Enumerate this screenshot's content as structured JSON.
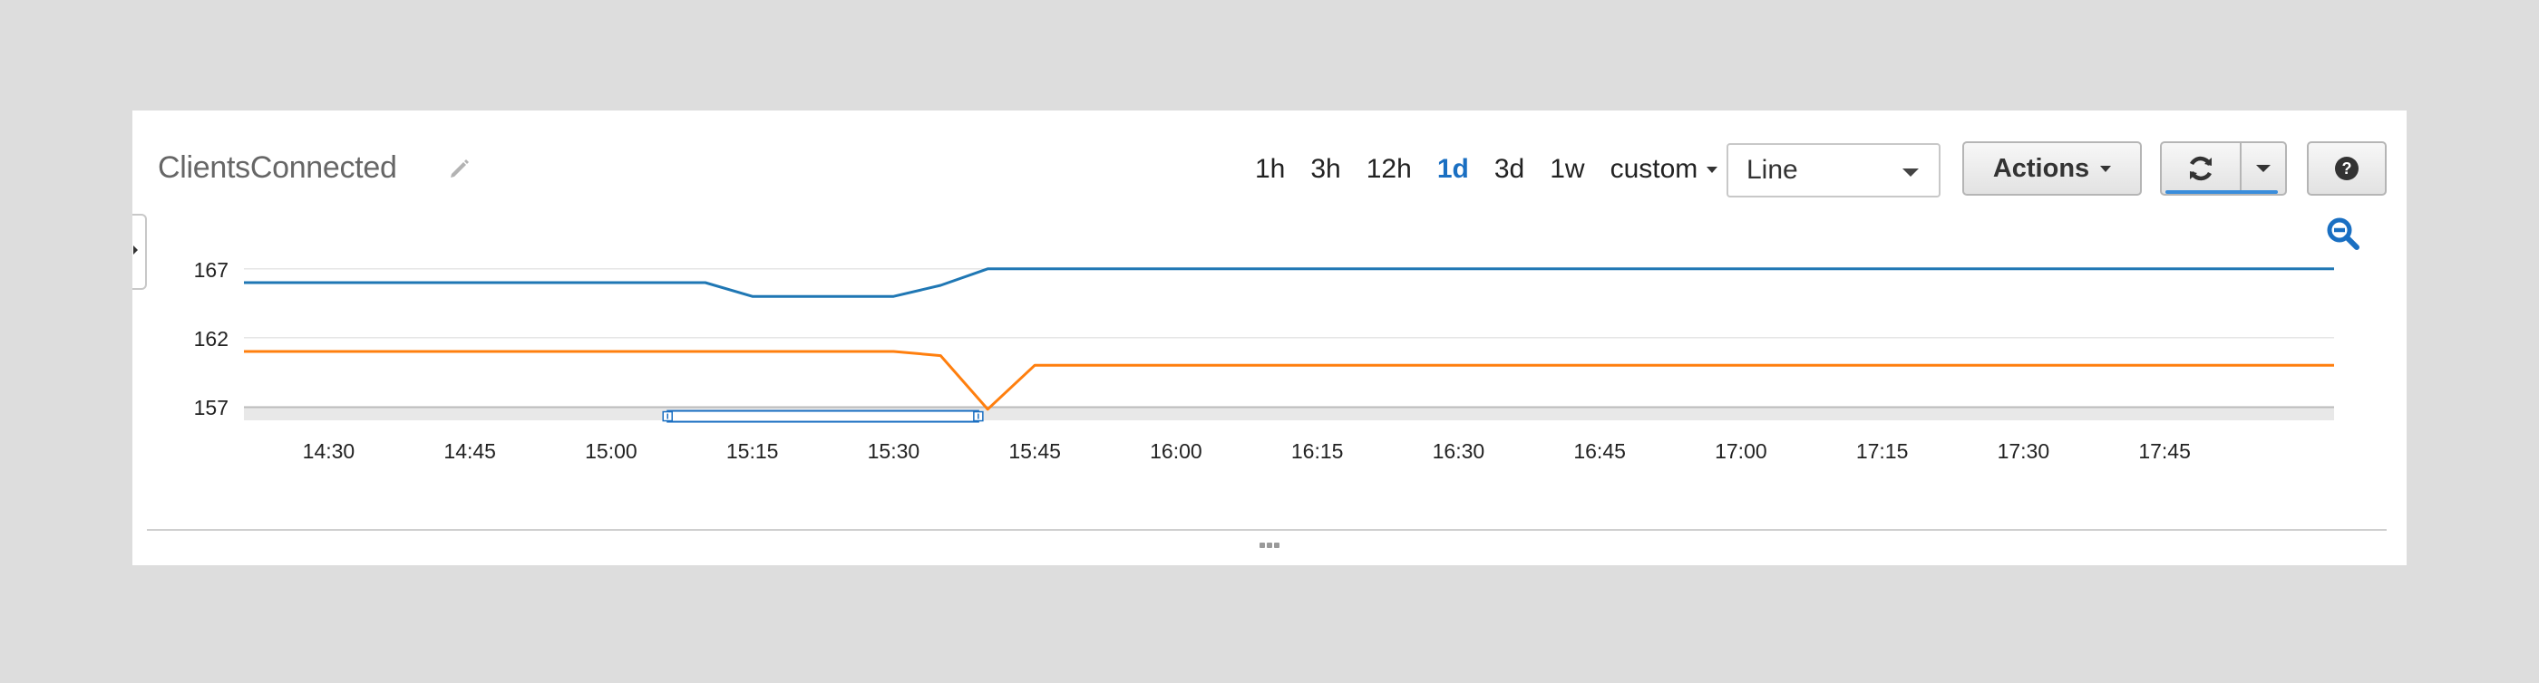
{
  "widget": {
    "title": "ClientsConnected",
    "edit_icon": "pencil-icon"
  },
  "toolbar": {
    "ranges": [
      {
        "label": "1h",
        "active": false
      },
      {
        "label": "3h",
        "active": false
      },
      {
        "label": "12h",
        "active": false
      },
      {
        "label": "1d",
        "active": true
      },
      {
        "label": "3d",
        "active": false
      },
      {
        "label": "1w",
        "active": false
      }
    ],
    "custom_label": "custom",
    "chart_type_value": "Line",
    "actions_label": "Actions",
    "refresh_icon": "refresh-icon",
    "help_icon": "help-icon",
    "zoom_out_icon": "zoom-out-icon"
  },
  "colors": {
    "series_blue": "#1f77b4",
    "series_orange": "#ff7f0e",
    "accent": "#1a6fc2"
  },
  "chart_data": {
    "type": "line",
    "x_ticks": [
      "14:30",
      "14:45",
      "15:00",
      "15:15",
      "15:30",
      "15:45",
      "16:00",
      "16:15",
      "16:30",
      "16:45",
      "17:00",
      "17:15",
      "17:30",
      "17:45"
    ],
    "y_ticks": [
      157,
      162,
      167
    ],
    "ylim": [
      156,
      168.5
    ],
    "xlim": [
      "14:21",
      "18:03"
    ],
    "grid": true,
    "series": [
      {
        "color": "#1f77b4",
        "points": [
          [
            "14:21",
            166
          ],
          [
            "15:10",
            166
          ],
          [
            "15:15",
            165
          ],
          [
            "15:30",
            165
          ],
          [
            "15:35",
            165.8
          ],
          [
            "15:40",
            167
          ],
          [
            "18:03",
            167
          ]
        ]
      },
      {
        "color": "#ff7f0e",
        "points": [
          [
            "14:21",
            161
          ],
          [
            "15:30",
            161
          ],
          [
            "15:35",
            160.7
          ],
          [
            "15:40",
            156.8
          ],
          [
            "15:45",
            160
          ],
          [
            "18:03",
            160
          ]
        ]
      }
    ],
    "selection": {
      "from": "15:06",
      "to": "15:39"
    }
  }
}
